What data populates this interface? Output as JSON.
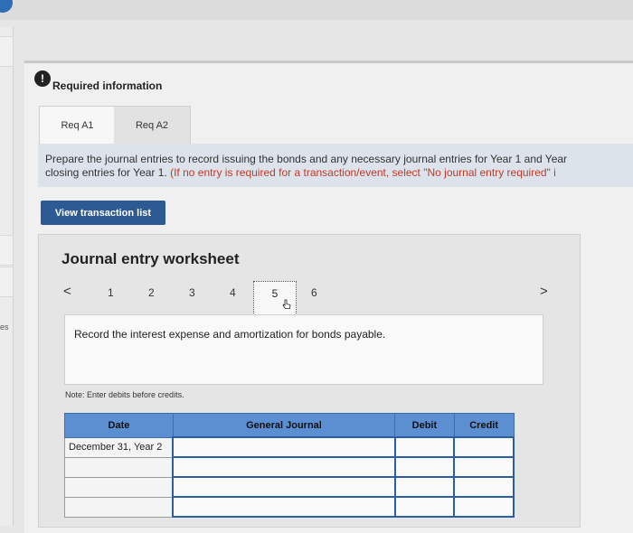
{
  "sidebar": {
    "partial_text": "es"
  },
  "alert": {
    "icon_glyph": "!",
    "title": "Required information"
  },
  "tabs": [
    {
      "label": "Req A1"
    },
    {
      "label": "Req A2"
    }
  ],
  "instructions": {
    "line1": "Prepare the journal entries to record issuing the bonds and any necessary journal entries for Year 1 and Year",
    "line2_start": "closing entries for Year 1.",
    "line2_red": " (If no entry is required for a transaction/event, select \"No journal entry required\" i"
  },
  "buttons": {
    "view_transaction_list": "View transaction list"
  },
  "worksheet": {
    "title": "Journal entry worksheet",
    "nav_prev": "<",
    "nav_next": ">",
    "pages": [
      "1",
      "2",
      "3",
      "4",
      "5",
      "6"
    ],
    "current_page": "5",
    "record_text": "Record the interest expense and amortization for bonds payable.",
    "note": "Note: Enter debits before credits."
  },
  "journal_table": {
    "headers": [
      "Date",
      "General Journal",
      "Debit",
      "Credit"
    ],
    "rows": [
      [
        "December 31, Year 2",
        "",
        "",
        ""
      ],
      [
        "",
        "",
        "",
        ""
      ],
      [
        "",
        "",
        "",
        ""
      ],
      [
        "",
        "",
        "",
        ""
      ]
    ]
  },
  "colors": {
    "accent_button": "#2d5a93",
    "table_header": "#5b8fd1",
    "instruction_red": "#c0392b"
  }
}
